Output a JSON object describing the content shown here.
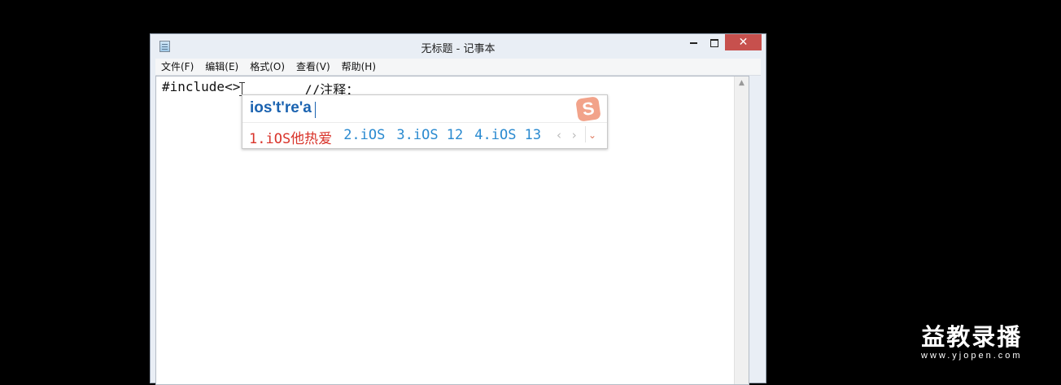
{
  "window": {
    "title": "无标题 - 记事本",
    "close_glyph": "✕"
  },
  "menu": [
    {
      "label": "文件(F)"
    },
    {
      "label": "编辑(E)"
    },
    {
      "label": "格式(O)"
    },
    {
      "label": "查看(V)"
    },
    {
      "label": "帮助(H)"
    }
  ],
  "editor": {
    "code_text": "#include<>",
    "comment_text": "//注释："
  },
  "ime": {
    "composition": "ios't're'a",
    "logo_letter": "S",
    "candidates": [
      {
        "label": "1.iOS他热爱"
      },
      {
        "label": "2.iOS"
      },
      {
        "label": "3.iOS 12"
      },
      {
        "label": "4.iOS 13"
      }
    ],
    "nav": "‹ ›",
    "more_glyph": "⌄"
  },
  "watermark": {
    "title": "益教录播",
    "url": "www.yjopen.com"
  },
  "colors": {
    "close_button": "#c7504d",
    "ime_composition": "#1b63b0",
    "candidate_first": "#d9342b",
    "candidate_other": "#2a8ad0",
    "ime_logo": "#f2a38a"
  }
}
